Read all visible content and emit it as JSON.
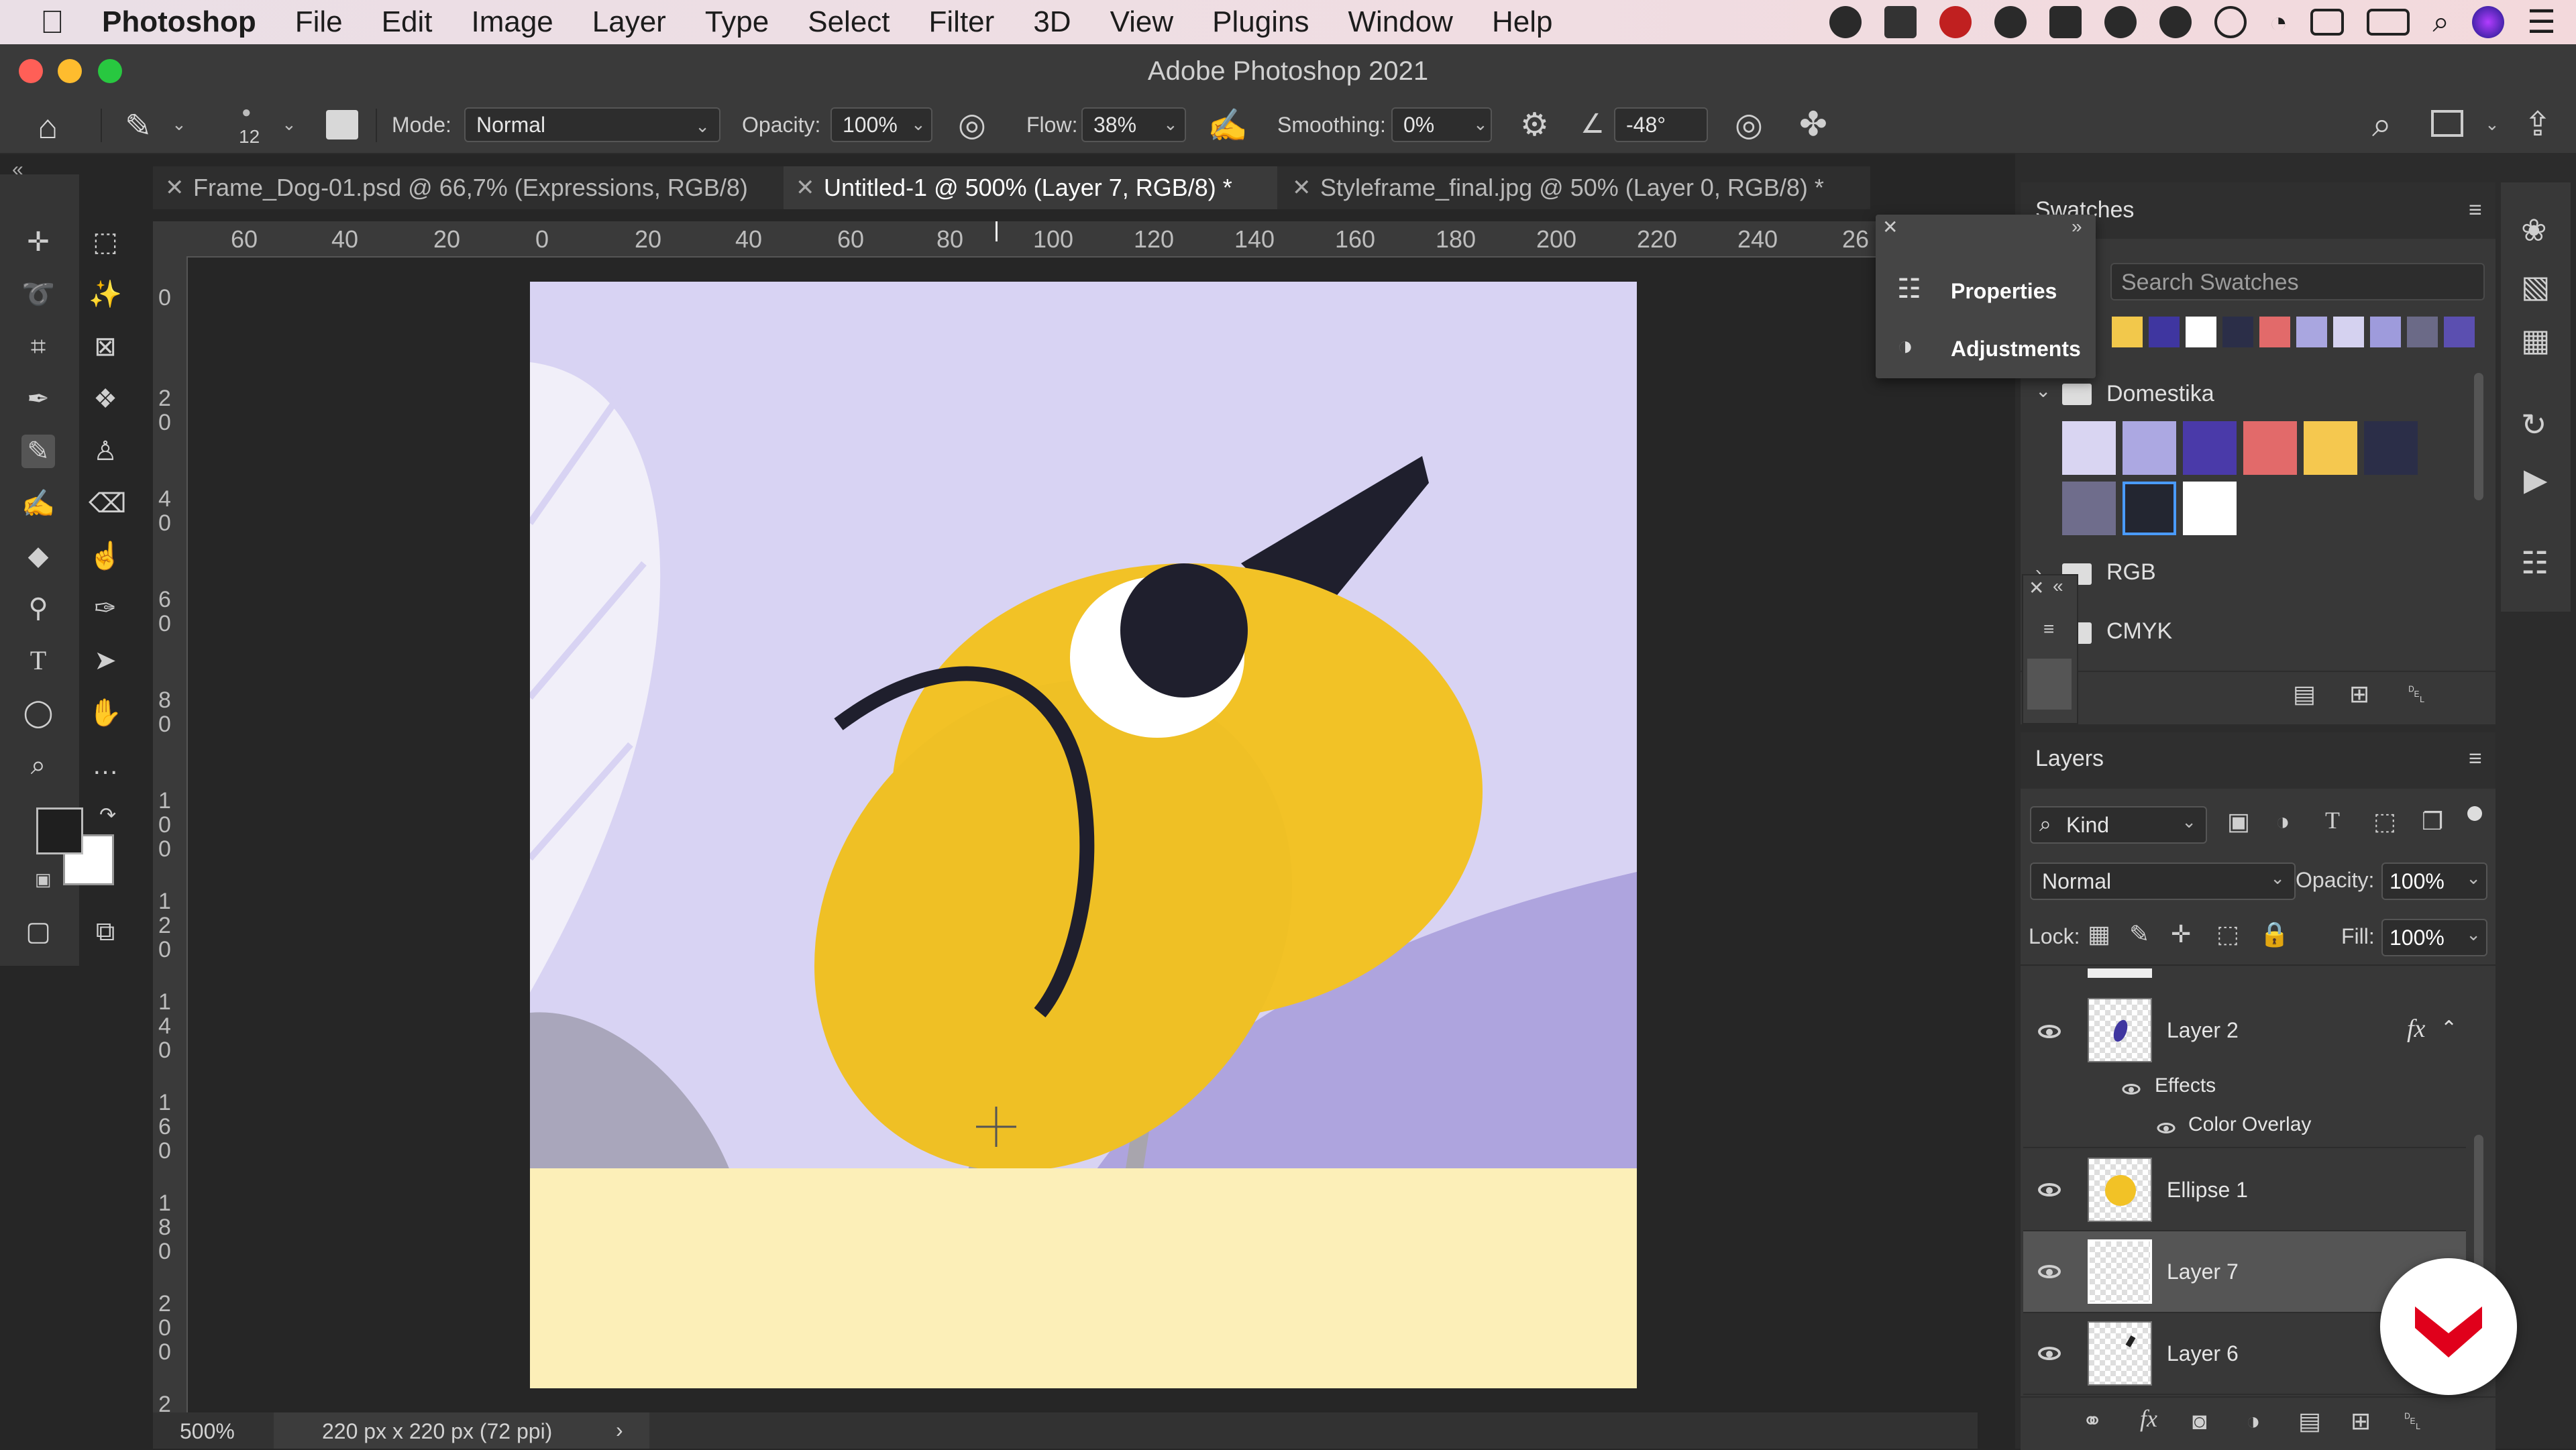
{
  "menubar": {
    "app_name": "Photoshop",
    "items": [
      "File",
      "Edit",
      "Image",
      "Layer",
      "Type",
      "Select",
      "Filter",
      "3D",
      "View",
      "Plugins",
      "Window",
      "Help"
    ]
  },
  "window": {
    "title": "Adobe Photoshop 2021"
  },
  "options_bar": {
    "brush_size": "12",
    "mode_label": "Mode:",
    "mode_value": "Normal",
    "opacity_label": "Opacity:",
    "opacity_value": "100%",
    "flow_label": "Flow:",
    "flow_value": "38%",
    "smoothing_label": "Smoothing:",
    "smoothing_value": "0%",
    "angle_value": "-48°"
  },
  "tabs": [
    {
      "label": "Frame_Dog-01.psd @ 66,7% (Expressions, RGB/8)"
    },
    {
      "label": "Untitled-1 @ 500% (Layer 7, RGB/8) *"
    },
    {
      "label": "Styleframe_final.jpg @ 50% (Layer 0, RGB/8) *"
    }
  ],
  "ruler": {
    "h_ticks": [
      "60",
      "40",
      "20",
      "0",
      "20",
      "40",
      "60",
      "80",
      "100",
      "120",
      "140",
      "160",
      "180",
      "200",
      "220",
      "240",
      "26"
    ],
    "v_ticks": [
      "0",
      "2\n0",
      "4\n0",
      "6\n0",
      "8\n0",
      "1\n0\n0",
      "1\n2\n0",
      "1\n4\n0",
      "1\n6\n0",
      "1\n8\n0",
      "2\n0\n0",
      "2"
    ]
  },
  "status": {
    "zoom": "500%",
    "doc_info": "220 px x 220 px (72 ppi)",
    "arrow": "›"
  },
  "popout": {
    "items": [
      "Properties",
      "Adjustments"
    ]
  },
  "swatches_panel": {
    "title": "Swatches",
    "search_placeholder": "Search Swatches",
    "recent_colors": [
      "#f2c84b",
      "#3f36a0",
      "#ffffff",
      "#2b2e48",
      "#e26a6a",
      "#a9a6e0",
      "#d5d2f0",
      "#9e9bdc",
      "#6b6a87",
      "#5b4fb0"
    ],
    "groups": [
      {
        "name": "Domestika",
        "colors": [
          "#d9d5f2",
          "#aca8e2",
          "#4a3aa9",
          "#e26a6a",
          "#f5c84f",
          "#2b2e48",
          "#6f6d8c",
          "#232631",
          "#ffffff"
        ]
      },
      {
        "name": "RGB"
      },
      {
        "name": "CMYK"
      }
    ]
  },
  "layers_panel": {
    "title": "Layers",
    "filter_kind": "Kind",
    "blend_mode": "Normal",
    "opacity_label": "Opacity:",
    "opacity_value": "100%",
    "lock_label": "Lock:",
    "fill_label": "Fill:",
    "fill_value": "100%",
    "layers": [
      {
        "name": "Layer 2",
        "fx": "fx",
        "effects_label": "Effects",
        "effect": "Color Overlay"
      },
      {
        "name": "Ellipse 1"
      },
      {
        "name": "Layer 7"
      },
      {
        "name": "Layer 6"
      }
    ]
  },
  "colors": {
    "canvas_bg": "#d8d3f3",
    "bird_yellow": "#f2c226",
    "ground": "#fcefb8",
    "hill": "#aea4de",
    "accent_logo": "#e0001b"
  }
}
